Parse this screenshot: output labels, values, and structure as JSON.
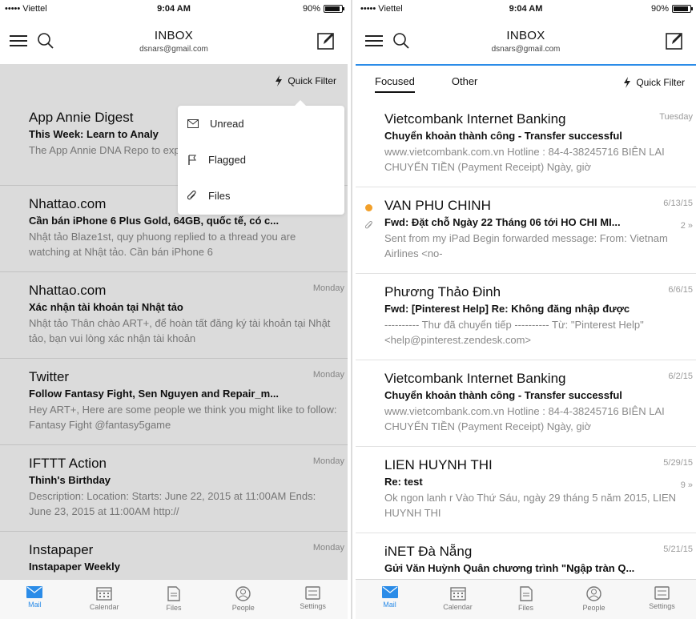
{
  "status": {
    "carrier": "••••• Viettel",
    "time": "9:04 AM",
    "battery": "90%"
  },
  "header": {
    "title": "INBOX",
    "account": "dsnars@gmail.com"
  },
  "quick_filter_label": "Quick Filter",
  "filter_menu": {
    "items": [
      "Unread",
      "Flagged",
      "Files"
    ]
  },
  "tabs": {
    "focused": "Focused",
    "other": "Other"
  },
  "left_messages": [
    {
      "sender": "App Annie Digest",
      "subject": "This Week: Learn to Analy",
      "preview": "The App Annie DNA Repo to expanding your app, us",
      "date": ""
    },
    {
      "sender": "Nhattao.com",
      "subject": "Cần bán iPhone 6 Plus Gold, 64GB, quốc tế, có c...",
      "preview": "Nhật tảo Blaze1st, quy phuong replied to a thread you are watching at Nhật tảo. Cần bán iPhone 6",
      "date": ""
    },
    {
      "sender": "Nhattao.com",
      "subject": "Xác nhận tài khoản tại Nhật tảo",
      "preview": "Nhật tảo Thân chào ART+, để hoàn tất đăng ký tài khoản tại Nhật tảo, bạn vui lòng xác nhận tài khoản",
      "date": "Monday"
    },
    {
      "sender": "Twitter",
      "subject": "Follow Fantasy Fight, Sen Nguyen and Repair_m...",
      "preview": "Hey ART+, Here are some people we think you might like to follow: Fantasy Fight @fantasy5game",
      "date": "Monday"
    },
    {
      "sender": "IFTTT Action",
      "subject": "Thinh's Birthday",
      "preview": "Description: Location: Starts: June 22, 2015 at 11:00AM Ends: June 23, 2015 at 11:00AM http://",
      "date": "Monday"
    },
    {
      "sender": "Instapaper",
      "subject": "Instapaper Weekly",
      "preview": "",
      "date": "Monday"
    }
  ],
  "right_messages": [
    {
      "sender": "Vietcombank Internet Banking",
      "subject": "Chuyển khoản thành công - Transfer successful",
      "preview": "www.vietcombank.com.vn Hotline : 84-4-38245716 BIÊN LAI CHUYỂN TIỀN (Payment Receipt) Ngày, giờ",
      "date": "Tuesday",
      "count": ""
    },
    {
      "sender": "VAN PHU CHINH",
      "subject": "Fwd: Đặt chỗ Ngày 22 Tháng 06 tới HO CHI MI...",
      "preview": "Sent from my iPad Begin forwarded message: From: Vietnam Airlines <no-",
      "date": "6/13/15",
      "count": "2 »"
    },
    {
      "sender": "Phương Thảo Đinh",
      "subject": "Fwd: [Pinterest Help] Re: Không đăng nhập được",
      "preview": "---------- Thư đã chuyển tiếp ---------- Từ: \"Pinterest Help\" <help@pinterest.zendesk.com>",
      "date": "6/6/15",
      "count": ""
    },
    {
      "sender": "Vietcombank Internet Banking",
      "subject": "Chuyển khoản thành công - Transfer successful",
      "preview": "www.vietcombank.com.vn Hotline : 84-4-38245716 BIÊN LAI CHUYỂN TIỀN (Payment Receipt) Ngày, giờ",
      "date": "6/2/15",
      "count": ""
    },
    {
      "sender": "LIEN HUYNH THI",
      "subject": "Re: test",
      "preview": "Ok ngon lanh r Vào Thứ Sáu, ngày 29 tháng 5 năm 2015, LIEN HUYNH THI",
      "date": "5/29/15",
      "count": "9 »"
    },
    {
      "sender": "iNET Đà Nẵng",
      "subject": "Gửi Văn Huỳnh Quân chương trình \"Ngập tràn Q...",
      "preview": "",
      "date": "5/21/15",
      "count": ""
    }
  ],
  "tabbar": {
    "mail": "Mail",
    "calendar": "Calendar",
    "files": "Files",
    "people": "People",
    "settings": "Settings"
  },
  "colors": {
    "accent": "#2b8ce8",
    "unread_dot": "#f2a02a"
  },
  "icons": [
    "menu-icon",
    "search-icon",
    "compose-icon",
    "lightning-icon",
    "envelope-icon",
    "flag-icon",
    "paperclip-icon",
    "calendar-icon",
    "file-icon",
    "people-icon",
    "settings-icon"
  ]
}
